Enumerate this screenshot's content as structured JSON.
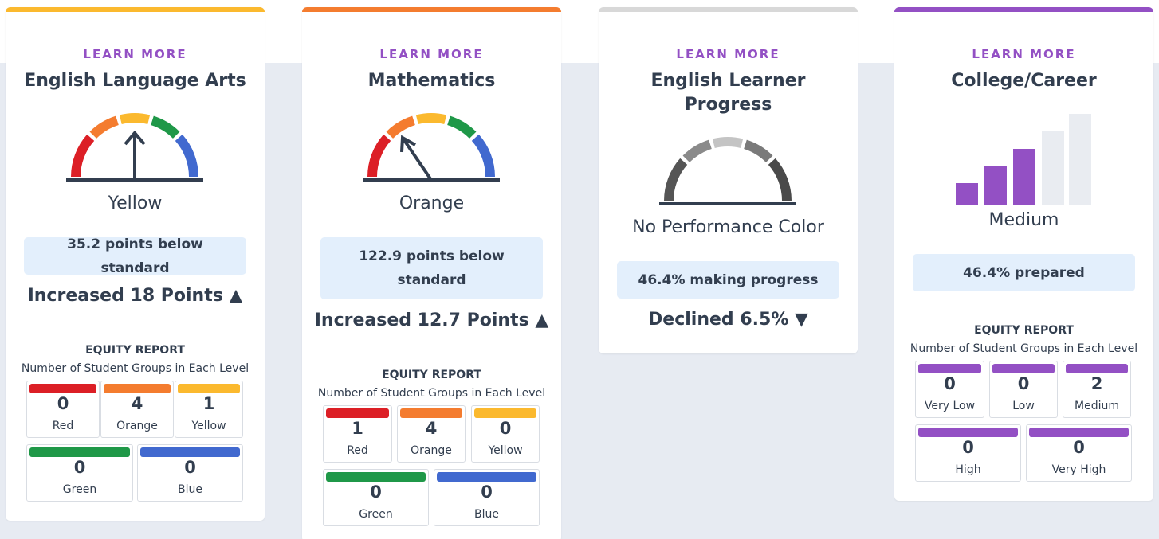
{
  "colors": {
    "red": "#dc1f26",
    "orange": "#f47c2f",
    "yellow": "#fbb92e",
    "green": "#1f9848",
    "blue": "#4169cf",
    "purple": "#9350c4",
    "gray": "#d8d8d8",
    "band": "#e7ebf2",
    "status_bg": "#e3effc"
  },
  "cards": [
    {
      "learn_more": "LEARN MORE",
      "title": "English Language Arts",
      "gauge_icon": "speedometer-gauge-icon",
      "performance_level": "Yellow",
      "status": "35.2 points below standard",
      "change": "Increased 18 Points ▲",
      "equity": {
        "title": "EQUITY REPORT",
        "subtitle": "Number of Student Groups in Each Level",
        "levels": [
          {
            "count": "0",
            "label": "Red"
          },
          {
            "count": "4",
            "label": "Orange"
          },
          {
            "count": "1",
            "label": "Yellow"
          },
          {
            "count": "0",
            "label": "Green"
          },
          {
            "count": "0",
            "label": "Blue"
          }
        ]
      }
    },
    {
      "learn_more": "LEARN MORE",
      "title": "Mathematics",
      "gauge_icon": "speedometer-gauge-icon",
      "performance_level": "Orange",
      "status": "122.9 points below standard",
      "change": "Increased 12.7 Points ▲",
      "equity": {
        "title": "EQUITY REPORT",
        "subtitle": "Number of Student Groups in Each Level",
        "levels": [
          {
            "count": "1",
            "label": "Red"
          },
          {
            "count": "4",
            "label": "Orange"
          },
          {
            "count": "0",
            "label": "Yellow"
          },
          {
            "count": "0",
            "label": "Green"
          },
          {
            "count": "0",
            "label": "Blue"
          }
        ]
      }
    },
    {
      "learn_more": "LEARN MORE",
      "title_line1": "English Learner",
      "title_line2": "Progress",
      "gauge_icon": "gray-gauge-icon",
      "performance_level": "No Performance Color",
      "status": "46.4% making progress",
      "change": "Declined 6.5% ▼"
    },
    {
      "learn_more": "LEARN MORE",
      "title": "College/Career",
      "gauge_icon": "bar-levels-icon",
      "performance_level": "Medium",
      "status": "46.4% prepared",
      "equity": {
        "title": "EQUITY REPORT",
        "subtitle": "Number of Student Groups in Each Level",
        "levels": [
          {
            "count": "0",
            "label": "Very Low"
          },
          {
            "count": "0",
            "label": "Low"
          },
          {
            "count": "2",
            "label": "Medium"
          },
          {
            "count": "0",
            "label": "High"
          },
          {
            "count": "0",
            "label": "Very High"
          }
        ]
      }
    }
  ]
}
